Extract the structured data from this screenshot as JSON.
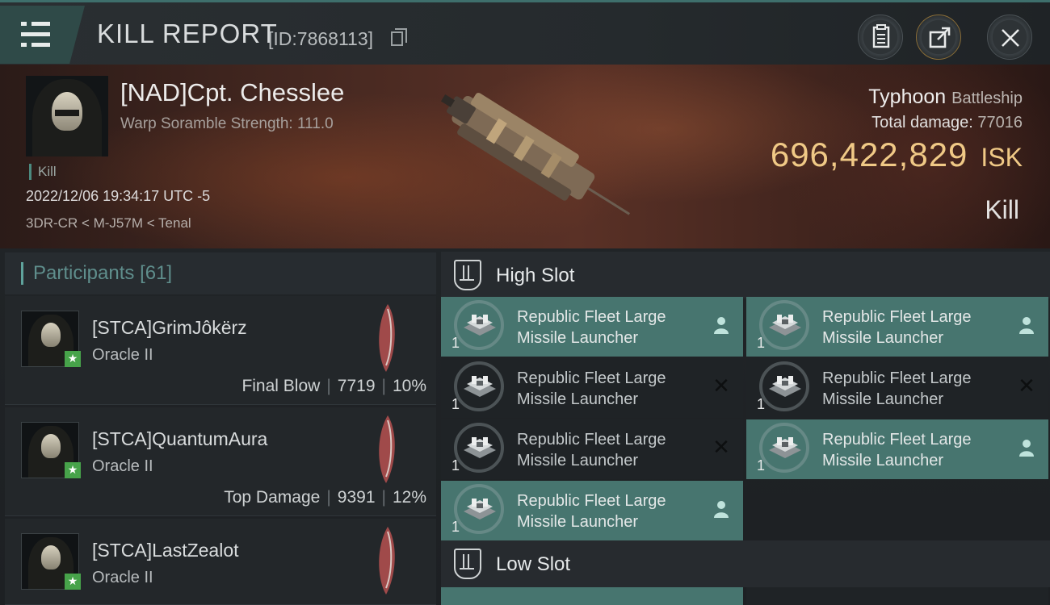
{
  "header": {
    "title": "KILL REPORT",
    "report_id": "[ID:7868113]"
  },
  "victim": {
    "name": "[NAD]Cpt. Chesslee",
    "scramble": "Warp Soramble Strength: 111.0",
    "tag": "Kill",
    "timestamp": "2022/12/06 19:34:17 UTC -5",
    "location": "3DR-CR < M-J57M < Tenal",
    "ship_name": "Typhoon",
    "ship_class": "Battleship",
    "total_damage_label": "Total damage:",
    "total_damage": "77016",
    "isk_value": "696,422,829",
    "isk_unit": "ISK",
    "result": "Kill"
  },
  "participants": {
    "label": "Participants",
    "count": "[61]",
    "items": [
      {
        "name": "[STCA]GrimJôkërz",
        "ship": "Oracle II",
        "role": "Final Blow",
        "damage": "7719",
        "percent": "10%"
      },
      {
        "name": "[STCA]QuantumAura",
        "ship": "Oracle II",
        "role": "Top Damage",
        "damage": "9391",
        "percent": "12%"
      },
      {
        "name": "[STCA]LastZealot",
        "ship": "Oracle II",
        "role": "",
        "damage": "",
        "percent": ""
      }
    ]
  },
  "high_slot": {
    "label": "High Slot",
    "modules": [
      {
        "line1": "Republic Fleet Large",
        "line2": "Missile Launcher",
        "qty": "1",
        "status": "dropped"
      },
      {
        "line1": "Republic Fleet Large",
        "line2": "Missile Launcher",
        "qty": "1",
        "status": "dropped"
      },
      {
        "line1": "Republic Fleet Large",
        "line2": "Missile Launcher",
        "qty": "1",
        "status": "destroyed"
      },
      {
        "line1": "Republic Fleet Large",
        "line2": "Missile Launcher",
        "qty": "1",
        "status": "destroyed"
      },
      {
        "line1": "Republic Fleet Large",
        "line2": "Missile Launcher",
        "qty": "1",
        "status": "destroyed"
      },
      {
        "line1": "Republic Fleet Large",
        "line2": "Missile Launcher",
        "qty": "1",
        "status": "dropped"
      },
      {
        "line1": "Republic Fleet Large",
        "line2": "Missile Launcher",
        "qty": "1",
        "status": "dropped"
      }
    ]
  },
  "low_slot": {
    "label": "Low Slot"
  },
  "colors": {
    "accent": "#47756f",
    "isk": "#f0c986",
    "badge": "#47a34a"
  },
  "icons": [
    "menu-icon",
    "copy-icon",
    "clipboard-icon",
    "share-icon",
    "close-icon",
    "high-slot-icon",
    "low-slot-icon",
    "pilot-icon",
    "destroyed-x-icon",
    "star-badge-icon"
  ]
}
